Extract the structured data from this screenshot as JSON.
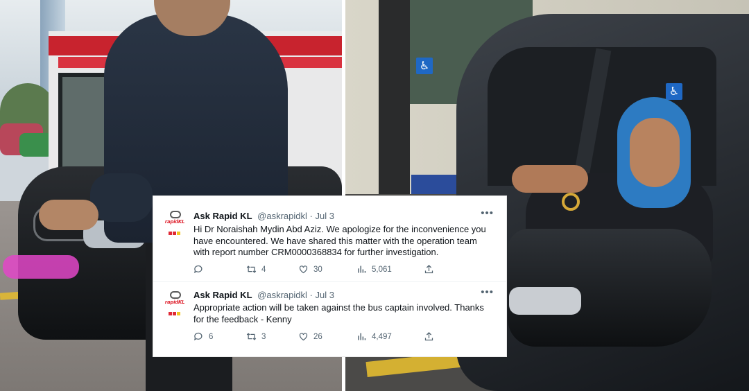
{
  "tweets": [
    {
      "display_name": "Ask Rapid KL",
      "handle": "@askrapidkl",
      "date": "Jul 3",
      "text": "Hi Dr Noraishah Mydin Abd Aziz. We apologize for the inconvenience you have encountered. We have shared this matter with the operation team with report number CRM0000368834 for further investigation.",
      "replies": "",
      "retweets": "4",
      "likes": "30",
      "views": "5,061"
    },
    {
      "display_name": "Ask Rapid KL",
      "handle": "@askrapidkl",
      "date": "Jul 3",
      "text": "Appropriate action will be taken against the bus captain involved. Thanks for the feedback - Kenny",
      "replies": "6",
      "retweets": "3",
      "likes": "26",
      "views": "4,497"
    }
  ],
  "avatar_brand": "rapidKL",
  "separator": "·",
  "more_glyph": "•••",
  "accessibility_sign": "♿",
  "colors": {
    "text_primary": "#0f1419",
    "text_secondary": "#536471",
    "brand_red": "#e02a36",
    "wheelchair_sign": "#1f68c4"
  },
  "icons": [
    "reply-icon",
    "retweet-icon",
    "like-icon",
    "views-icon",
    "share-icon",
    "more-icon"
  ]
}
